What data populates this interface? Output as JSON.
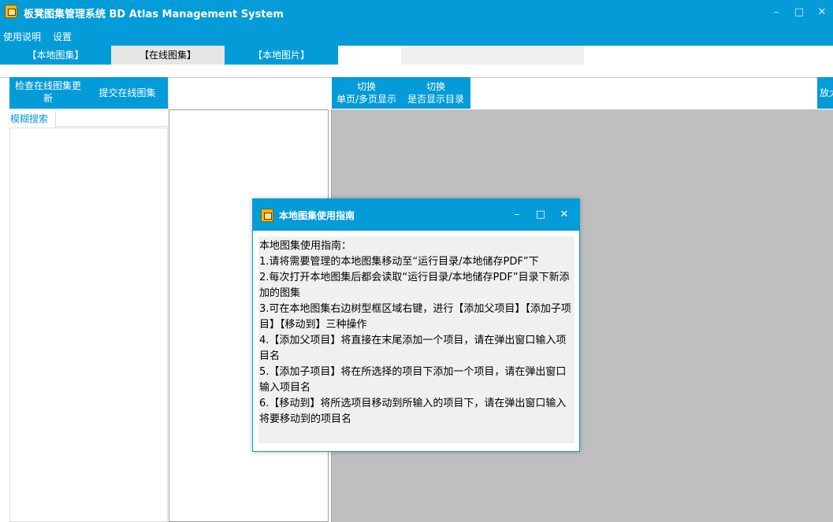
{
  "window": {
    "title": "板凳图集管理系统 BD Atlas Management System",
    "minimize": "–",
    "maximize": "□",
    "close": "✕"
  },
  "menu": {
    "items": [
      "使用说明",
      "设置"
    ]
  },
  "tabs": [
    "【本地图集】",
    "【在线图集】",
    "【本地图片】"
  ],
  "toolbar": {
    "check_update": "检查在线图集更新",
    "submit_online": "提交在线图集",
    "toggle_page_line1": "切换",
    "toggle_page_line2": "单页/多页显示",
    "toggle_toc_line1": "切换",
    "toggle_toc_line2": "是否显示目录",
    "zoom": "放大"
  },
  "search": {
    "label": "模糊搜索",
    "value": ""
  },
  "dialog": {
    "title": "本地图集使用指南",
    "minimize": "–",
    "maximize": "□",
    "close": "✕",
    "lines": [
      "本地图集使用指南：",
      "1.请将需要管理的本地图集移动至“运行目录/本地储存PDF”下",
      "2.每次打开本地图集后都会读取“运行目录/本地储存PDF”目录下新添加的图集",
      "3.可在本地图集右边树型框区域右键，进行【添加父项目】【添加子项目】【移动到】三种操作",
      "4.【添加父项目】将直接在末尾添加一个项目，请在弹出窗口输入项目名",
      "5.【添加子项目】将在所选择的项目下添加一个项目，请在弹出窗口输入项目名",
      "6.【移动到】将所选项目移动到所输入的项目下，请在弹出窗口输入将要移动到的项目名"
    ]
  },
  "colors": {
    "accent": "#049bd9",
    "viewer_bg": "#bfbfbf",
    "panel_bg": "#f0f0f0"
  }
}
